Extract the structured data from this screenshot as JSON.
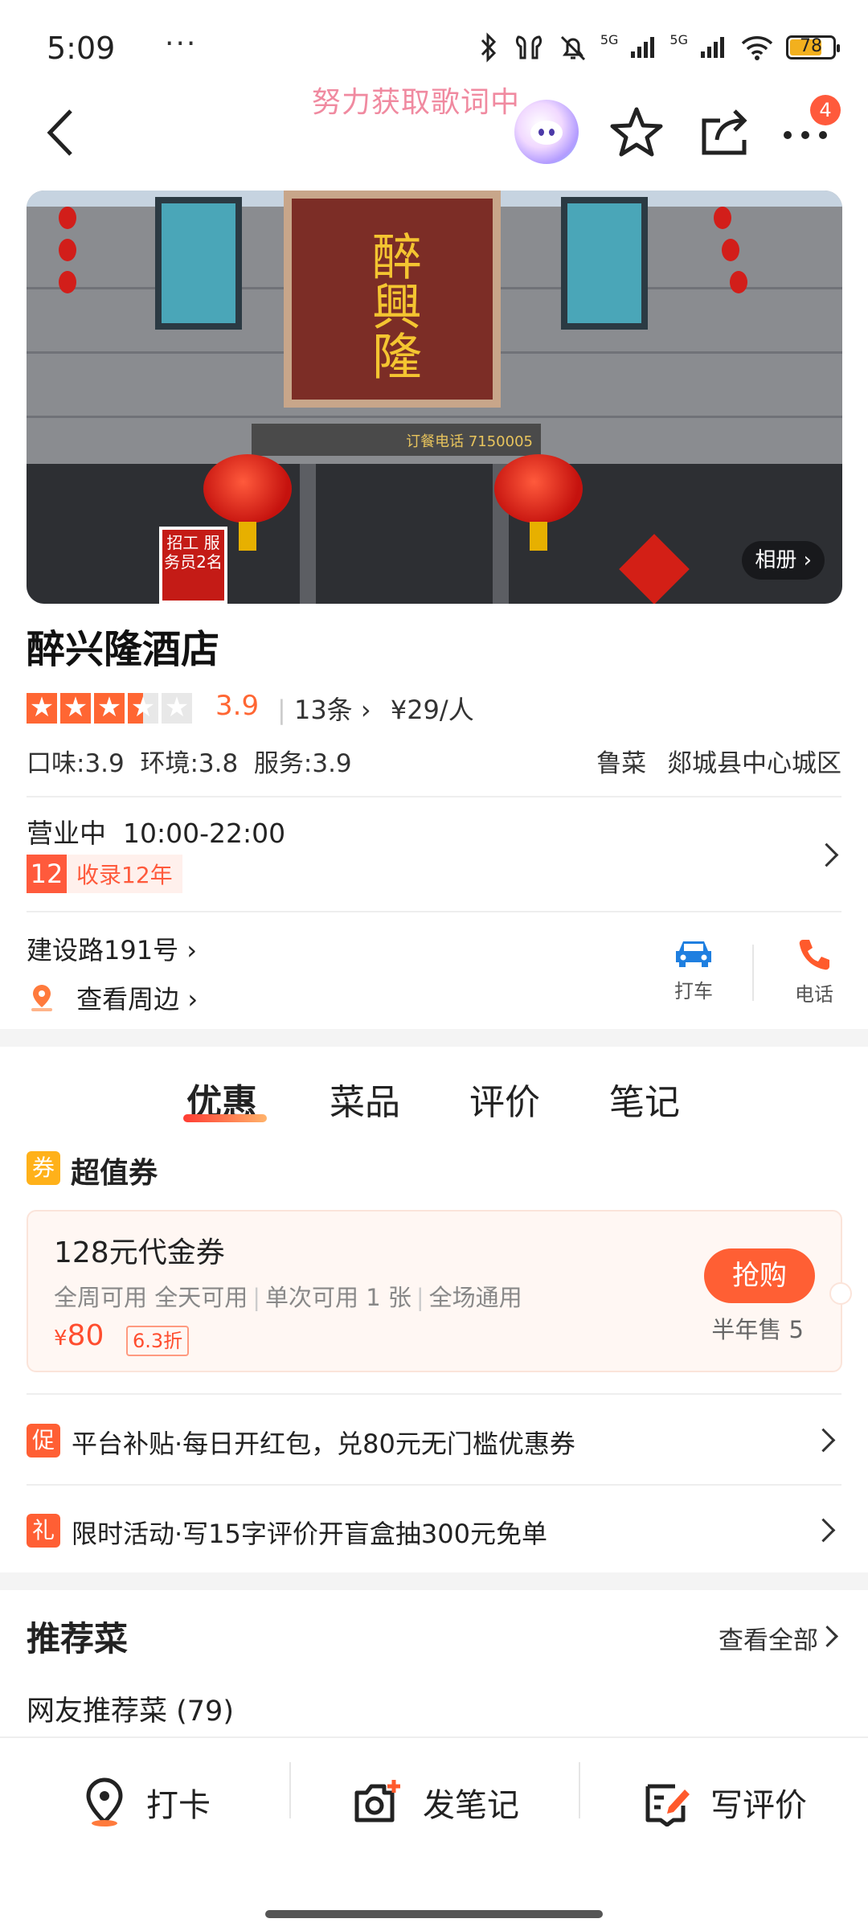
{
  "status_bar": {
    "time": "5:09",
    "more": "···",
    "battery": "78",
    "network_1": "5G",
    "network_2": "5G"
  },
  "header": {
    "lyric_banner": "努力获取歌词中",
    "notification_count": "4"
  },
  "hero": {
    "sign_text": "醉興隆",
    "phone_sign": "订餐电话 7150005",
    "recruit_sign": "招工 服务员2名",
    "album_label": "相册"
  },
  "shop": {
    "name": "醉兴隆酒店",
    "rating": "3.9",
    "rating_value": 3.5,
    "review_count": "13条",
    "price_per_person": "¥29/人",
    "scores": "口味:3.9  环境:3.8  服务:3.9",
    "cuisine": "鲁菜",
    "area": "郯城县中心城区",
    "status": "营业中  10:00-22:00",
    "years_num": "12",
    "years_label": "收录12年",
    "address": "建设路191号",
    "nearby": "查看周边",
    "taxi_label": "打车",
    "phone_label": "电话"
  },
  "tabs": [
    {
      "label": "优惠"
    },
    {
      "label": "菜品"
    },
    {
      "label": "评价"
    },
    {
      "label": "笔记"
    }
  ],
  "coupon_section": {
    "icon_text": "券",
    "title": "超值券",
    "card": {
      "title": "128元代金券",
      "desc_1": "全周可用 全天可用",
      "desc_2": "单次可用 1 张",
      "desc_3": "全场通用",
      "currency": "¥",
      "price": "80",
      "discount": "6.3折",
      "buy_label": "抢购",
      "sold": "半年售 5"
    }
  },
  "promos": [
    {
      "icon": "促",
      "text": "平台补贴·每日开红包，兑80元无门槛优惠券"
    },
    {
      "icon": "礼",
      "text": "限时活动·写15字评价开盲盒抽300元免单"
    }
  ],
  "recommend": {
    "title": "推荐菜",
    "view_all": "查看全部",
    "subtitle": "网友推荐菜 (79)"
  },
  "bottom_bar": {
    "checkin": "打卡",
    "note": "发笔记",
    "review": "写评价"
  },
  "colors": {
    "accent": "#ff5f34",
    "star": "#ff6633",
    "badge": "#ff5a3c"
  }
}
